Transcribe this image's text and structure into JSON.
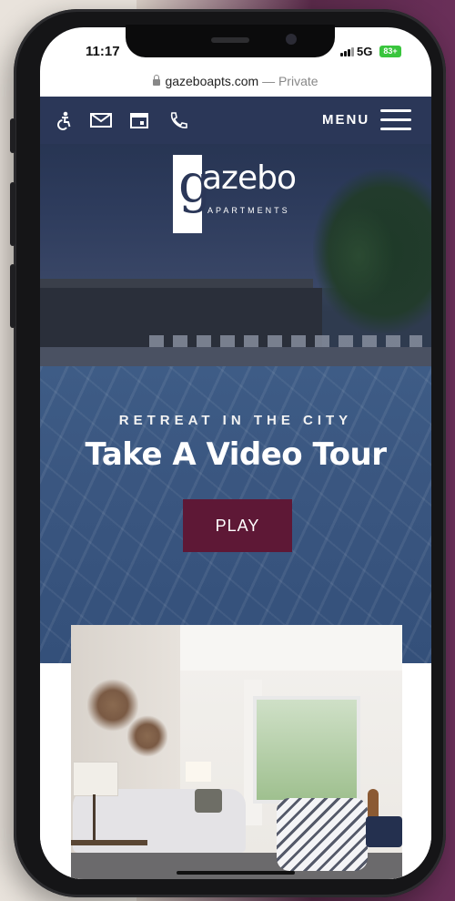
{
  "status_bar": {
    "time": "11:17",
    "network": "5G",
    "battery": "83+"
  },
  "browser": {
    "domain": "gazeboapts.com",
    "separator": " — ",
    "mode": "Private"
  },
  "site_header": {
    "icons": [
      "accessibility-icon",
      "mail-icon",
      "calendar-icon",
      "phone-icon"
    ],
    "menu_label": "MENU"
  },
  "logo": {
    "g_letter": "g",
    "wordmark": "azebo",
    "subtitle": "APARTMENTS"
  },
  "hero": {
    "tagline": "RETREAT IN THE CITY",
    "headline": "Take A Video Tour",
    "play_label": "PLAY"
  },
  "colors": {
    "nav_bg": "#2b3758",
    "play_button": "#5e1836",
    "pool_blue": "#3a5680"
  }
}
